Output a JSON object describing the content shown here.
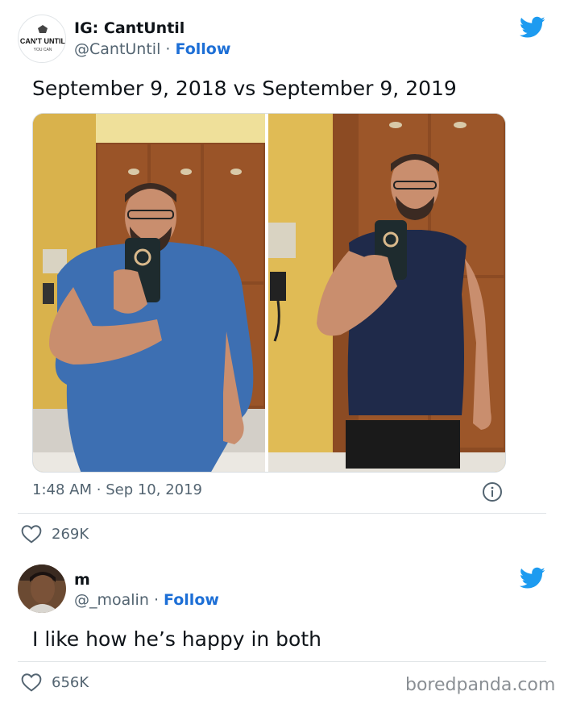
{
  "tweet1": {
    "avatar_text_top": "CAN'T UNTIL",
    "avatar_text_bottom": "YOU CAN",
    "name": "IG: CantUntil",
    "handle": "@CantUntil",
    "separator": "·",
    "follow_label": "Follow",
    "text": "September 9, 2018 vs September 9, 2019",
    "time": "1:48 AM",
    "date": "Sep 10, 2019",
    "likes": "269K"
  },
  "tweet2": {
    "name": "m",
    "handle": "@_moalin",
    "separator": "·",
    "follow_label": "Follow",
    "text": "I like how he’s happy in both",
    "likes": "656K"
  },
  "watermark": "boredpanda.com",
  "colors": {
    "accent": "#1d9bf0",
    "follow": "#1d6fd6",
    "secondary_text": "#536471",
    "divider": "#dfe3e6"
  },
  "icons": [
    "twitter-bird-icon",
    "heart-icon",
    "info-icon"
  ]
}
